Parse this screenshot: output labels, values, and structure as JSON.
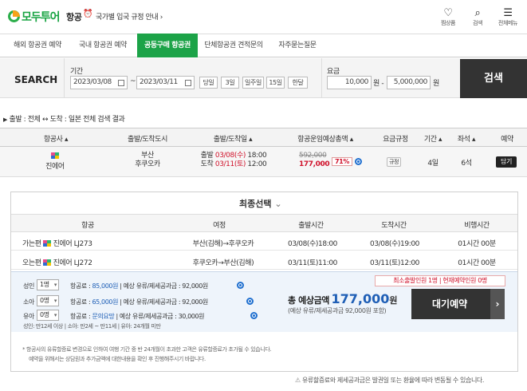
{
  "header": {
    "logo_text": "모두투어",
    "category": "항공",
    "alarm_icon": "⏰",
    "notice": "국가별 입국 규정 안내",
    "notice_arrow": "›",
    "icons": [
      {
        "name": "heart-icon",
        "glyph": "♡",
        "label": "찜상품"
      },
      {
        "name": "search-icon",
        "glyph": "⌕",
        "label": "검색"
      },
      {
        "name": "menu-icon",
        "glyph": "☰",
        "label": "전체메뉴"
      }
    ]
  },
  "nav": {
    "tabs": [
      "해외 항공권 예약",
      "국내 항공권 예약",
      "공동구매 항공권",
      "단체항공권 견적문의",
      "자주묻는질문"
    ],
    "active_index": 2
  },
  "search": {
    "label": "SEARCH",
    "period_label": "기간",
    "date_from": "2023/03/08",
    "date_sep": "~",
    "date_to": "2023/03/11",
    "quick": [
      "당일",
      "3일",
      "일주일",
      "15일",
      "한달"
    ],
    "price_label": "요금",
    "price_min": "10,000",
    "price_min_unit": "원 -",
    "price_max": "5,000,000",
    "price_max_unit": "원",
    "button": "검색"
  },
  "route": {
    "arrow": "▶",
    "text": "출발 : 전체 ↔ 도착 : 일본 전체 검색 결과"
  },
  "results": {
    "headers": [
      "항공사 ▴",
      "출발/도착도시",
      "출발/도착일 ▴",
      "항공운임예상총액 ▴",
      "요금규정",
      "기간 ▴",
      "좌석 ▴",
      "예약"
    ],
    "row": {
      "airline": "진에어",
      "city_from": "부산",
      "city_to": "후쿠오카",
      "dep_prefix": "출발",
      "dep_date": "03/08(수)",
      "dep_time": "18:00",
      "arr_prefix": "도착",
      "arr_date": "03/11(토)",
      "arr_time": "12:00",
      "orig_price": "592,000",
      "sale_price": "177,000",
      "discount": "71%",
      "rule": "규정",
      "period": "4일",
      "seats": "6석",
      "reserve": "담기"
    }
  },
  "final": {
    "title": "최종선택",
    "title_icon": "⌄",
    "headers": [
      "항공",
      "여정",
      "출발시간",
      "도착시간",
      "비행시간"
    ],
    "rows": [
      {
        "dir": "가는편",
        "airline": "진에어 LJ273",
        "route": "부산(김해)→후쿠오카",
        "dep": "03/08(수)18:00",
        "arr": "03/08(수)19:00",
        "dur": "01시간 00분"
      },
      {
        "dir": "오는편",
        "airline": "진에어 LJ272",
        "route": "후쿠오카→부산(김해)",
        "dep": "03/11(토)11:00",
        "arr": "03/11(토)12:00",
        "dur": "01시간 00분"
      }
    ]
  },
  "pricing": {
    "pax": [
      {
        "type": "성인",
        "count": "1명",
        "fare_label": "항공료 :",
        "fare": "85,000원",
        "extra": "| 예상 유류/제세공과금 : 92,000원"
      },
      {
        "type": "소아",
        "count": "0명",
        "fare_label": "항공료 :",
        "fare": "65,000원",
        "extra": "| 예상 유류/제세공과금 : 92,000원"
      },
      {
        "type": "유아",
        "count": "0명",
        "fare_label": "항공료 :",
        "fare": "문의요망",
        "extra": "| 예상 유류/제세공과금 : 30,000원"
      }
    ],
    "age_note": "성인: 만12세 이상 | 소아: 만2세 ~ 만11세 | 유아: 24개월 미만",
    "min_badge": "최소출발인원 1명 | 현재예약인원 0명",
    "total_label": "총 예상금액",
    "total_amount": "177,000",
    "total_unit": "원",
    "total_sub": "(예상 유류/제세공과금 92,000원 포함)",
    "wait_button": "대기예약",
    "wait_arrow": "›"
  },
  "notes": {
    "line1": "* 항공사의 유류할증료 변경으로 인하여 여행 기간 중 반 24개월이 초과한 고객은 유류할증료가 초가될 수 있습니다.",
    "line2": "예약을 위해서는 상담원과 추가금액에 대한내용을 확인 후 진행해주시기 바랍니다."
  },
  "footer": {
    "icon": "⚠",
    "note": "유류할증료와 제세공과금은 발권일 또는 환율에 따라 변동될 수 있습니다."
  },
  "colors": {
    "brand_green": "#1ca348",
    "sale_red": "#d0122b",
    "link_blue": "#1f5fb6"
  }
}
